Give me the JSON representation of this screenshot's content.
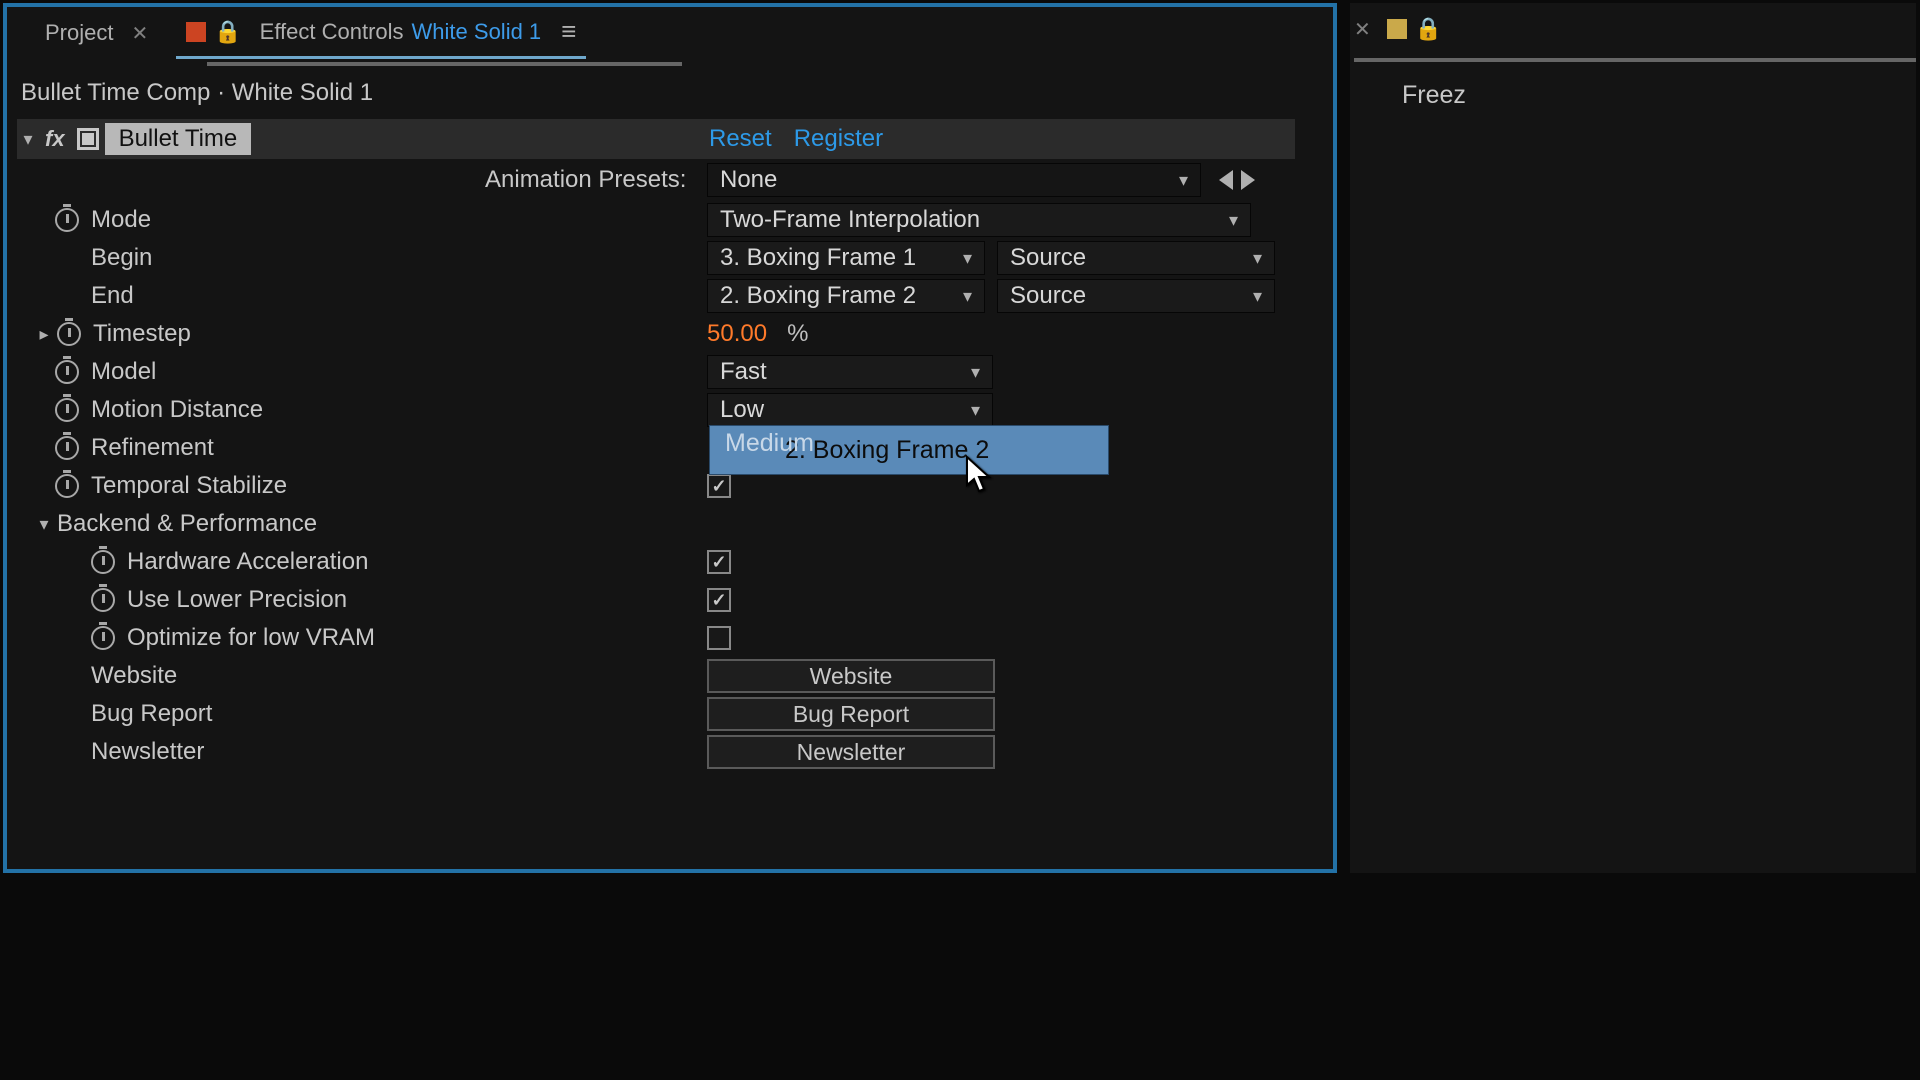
{
  "tabs": {
    "project": "Project",
    "effectControls": "Effect Controls",
    "layerName": "White Solid 1"
  },
  "breadcrumb": "Bullet Time Comp · White Solid 1",
  "effect": {
    "name": "Bullet Time",
    "reset": "Reset",
    "register": "Register"
  },
  "presetsLabel": "Animation Presets:",
  "presetsValue": "None",
  "params": {
    "mode": {
      "label": "Mode",
      "value": "Two-Frame Interpolation"
    },
    "begin": {
      "label": "Begin",
      "layer": "3. Boxing Frame 1",
      "src": "Source"
    },
    "end": {
      "label": "End",
      "layer": "2. Boxing Frame 2",
      "src": "Source"
    },
    "timestep": {
      "label": "Timestep",
      "value": "50.00",
      "unit": "%"
    },
    "model": {
      "label": "Model",
      "value": "Fast"
    },
    "motionDistance": {
      "label": "Motion Distance",
      "value": "Low"
    },
    "refinement": {
      "label": "Refinement",
      "value": "Medium"
    },
    "temporalStabilize": {
      "label": "Temporal Stabilize",
      "checked": true
    },
    "backendGroup": "Backend & Performance",
    "hardwareAccel": {
      "label": "Hardware Acceleration",
      "checked": true
    },
    "lowerPrecision": {
      "label": "Use Lower Precision",
      "checked": true
    },
    "lowVram": {
      "label": "Optimize for low VRAM",
      "checked": false
    },
    "website": {
      "label": "Website",
      "button": "Website"
    },
    "bugReport": {
      "label": "Bug Report",
      "button": "Bug Report"
    },
    "newsletter": {
      "label": "Newsletter",
      "button": "Newsletter"
    }
  },
  "tooltipItem": "2. Boxing Frame 2",
  "rightPanel": {
    "title": "Freez"
  }
}
